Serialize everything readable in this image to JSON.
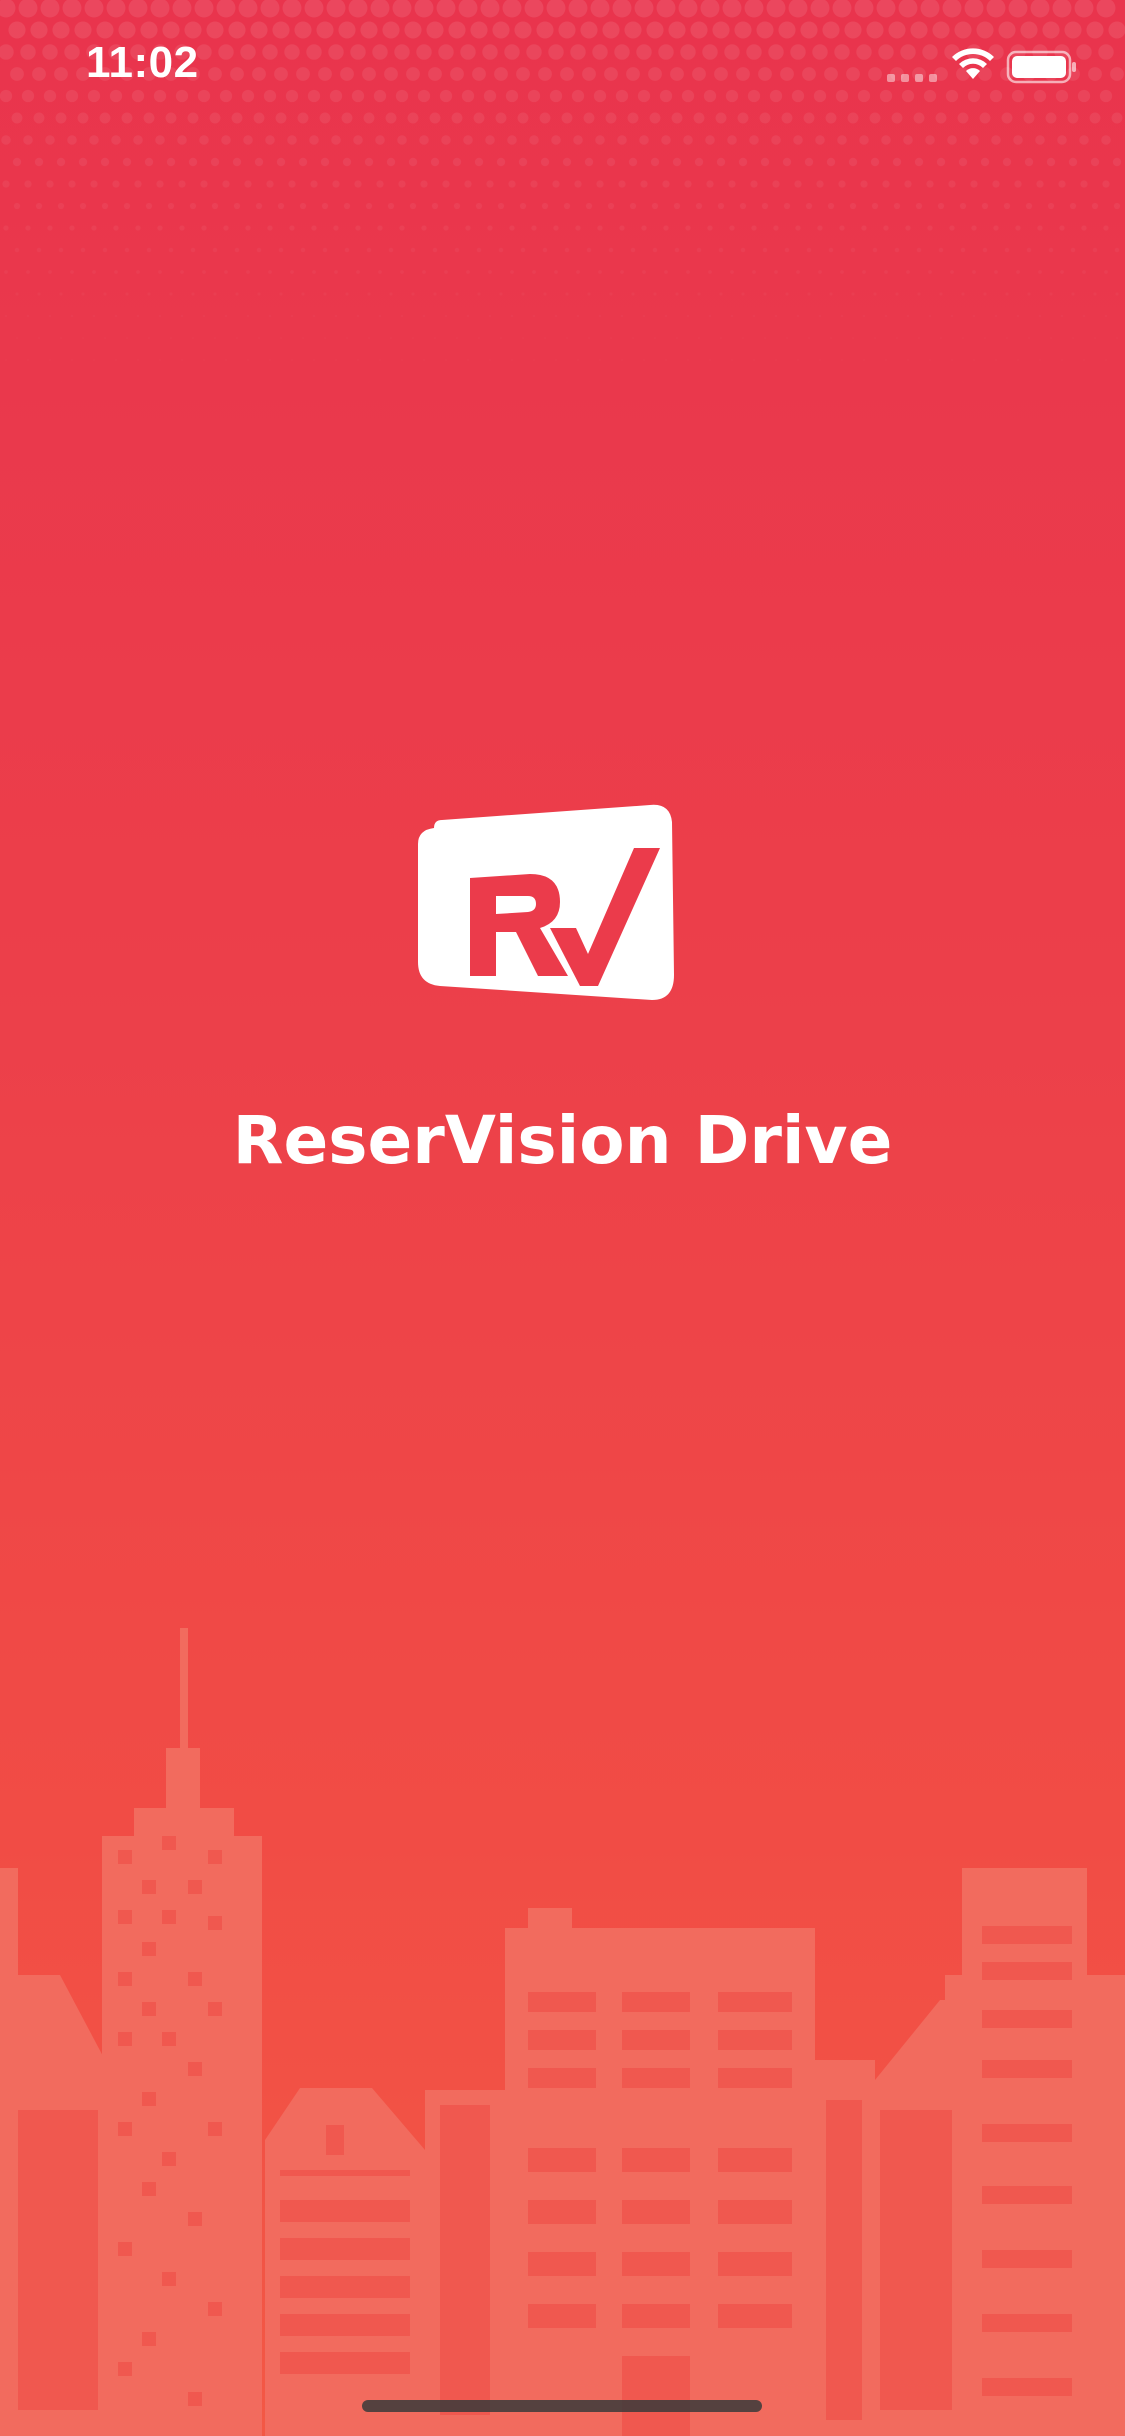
{
  "status_bar": {
    "time": "11:02",
    "signal_icon": "cellular-signal-icon",
    "wifi_icon": "wifi-icon",
    "battery_icon": "battery-icon"
  },
  "splash": {
    "logo_icon": "reservision-logo-icon",
    "app_name": "ReserVision Drive"
  },
  "colors": {
    "background_top": "#E9344D",
    "background_bottom": "#F35845",
    "skyline": "#F26B5E",
    "text": "#FFFFFF"
  }
}
